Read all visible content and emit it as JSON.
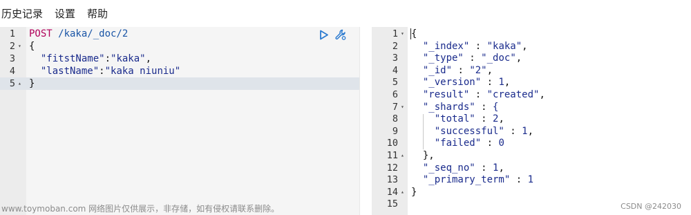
{
  "menu": {
    "history": "历史记录",
    "settings": "设置",
    "help": "帮助"
  },
  "request": {
    "lines": [
      {
        "n": "1",
        "fold": "",
        "method": "POST",
        "url": " /kaka/_doc/2"
      },
      {
        "n": "2",
        "fold": "▾",
        "text": "{"
      },
      {
        "n": "3",
        "fold": "",
        "key": "\"fitstName\"",
        "sep": ":",
        "val": "\"kaka\"",
        "tail": ","
      },
      {
        "n": "4",
        "fold": "",
        "key": "\"lastName\"",
        "sep": ":",
        "val": "\"kaka niuniu\"",
        "tail": ""
      },
      {
        "n": "5",
        "fold": "▴",
        "text": "}"
      }
    ],
    "toolbar": {
      "run_icon": "play-icon",
      "settings_icon": "wrench-icon"
    }
  },
  "response": {
    "lines": [
      {
        "n": "1",
        "fold": "▾",
        "text": "{"
      },
      {
        "n": "2",
        "fold": "",
        "key": "\"_index\"",
        "val": "\"kaka\"",
        "tail": ","
      },
      {
        "n": "3",
        "fold": "",
        "key": "\"_type\"",
        "val": "\"_doc\"",
        "tail": ","
      },
      {
        "n": "4",
        "fold": "",
        "key": "\"_id\"",
        "val": "\"2\"",
        "tail": ","
      },
      {
        "n": "5",
        "fold": "",
        "key": "\"_version\"",
        "val": "1",
        "tail": ","
      },
      {
        "n": "6",
        "fold": "",
        "key": "\"result\"",
        "val": "\"created\"",
        "tail": ","
      },
      {
        "n": "7",
        "fold": "▾",
        "key": "\"_shards\"",
        "val": "{",
        "tail": ""
      },
      {
        "n": "8",
        "fold": "",
        "key": "\"total\"",
        "val": "2",
        "tail": ","
      },
      {
        "n": "9",
        "fold": "",
        "key": "\"successful\"",
        "val": "1",
        "tail": ","
      },
      {
        "n": "10",
        "fold": "",
        "key": "\"failed\"",
        "val": "0",
        "tail": ""
      },
      {
        "n": "11",
        "fold": "▴",
        "text": "},"
      },
      {
        "n": "12",
        "fold": "",
        "key": "\"_seq_no\"",
        "val": "1",
        "tail": ","
      },
      {
        "n": "13",
        "fold": "",
        "key": "\"_primary_term\"",
        "val": "1",
        "tail": ""
      },
      {
        "n": "14",
        "fold": "▴",
        "text": "}"
      },
      {
        "n": "15",
        "fold": "",
        "text": ""
      }
    ]
  },
  "watermark": {
    "left": "www.toymoban.com 网络图片仅供展示，非存储，如有侵权请联系删除。",
    "right": "CSDN @242030"
  },
  "colors": {
    "method": "#b1005a",
    "url": "#1a55a6",
    "string": "#1a2b8c",
    "active_line": "#dfe4ea",
    "gutter": "#ececec"
  }
}
